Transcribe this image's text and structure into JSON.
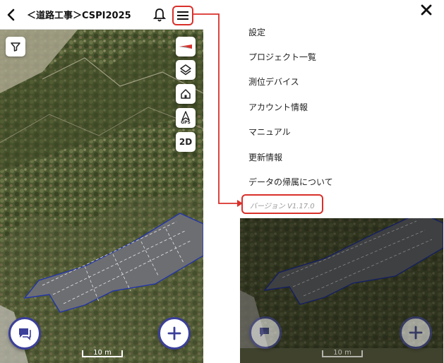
{
  "left": {
    "header": {
      "title": "＜道路工事＞CSPI2025"
    },
    "map_controls": {
      "gps_label": "GPS",
      "mode_label": "2D"
    },
    "scale_label": "10 m"
  },
  "right": {
    "menu": {
      "items": [
        {
          "label": "設定"
        },
        {
          "label": "プロジェクト一覧"
        },
        {
          "label": "測位デバイス"
        },
        {
          "label": "アカウント情報"
        },
        {
          "label": "マニュアル"
        },
        {
          "label": "更新情報"
        },
        {
          "label": "データの帰属について"
        }
      ],
      "version": "バージョン V1.17.0"
    },
    "scale_label": "10 m"
  },
  "colors": {
    "highlight": "#d9302a",
    "fab_border": "#3b3f9a"
  }
}
